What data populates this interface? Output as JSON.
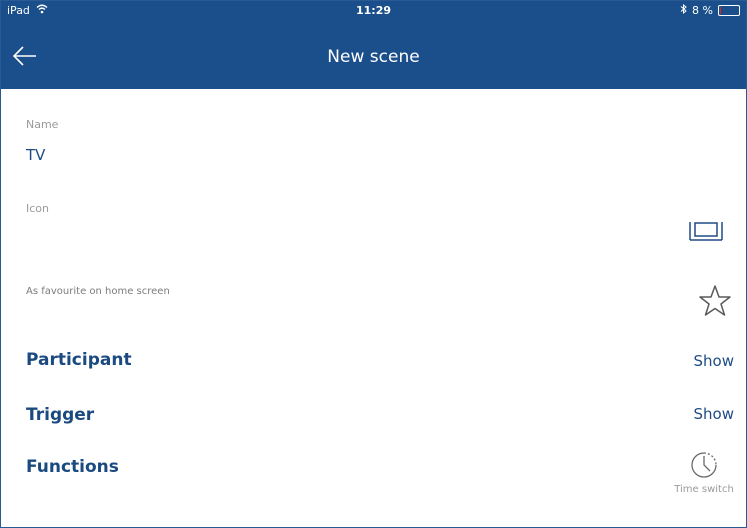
{
  "status_bar": {
    "device": "iPad",
    "time": "11:29",
    "battery_text": "8 %",
    "battery_level": 0.08,
    "battery_color": "#e0211f"
  },
  "nav": {
    "title": "New scene",
    "back_icon": "arrow-left-icon"
  },
  "form": {
    "name_label": "Name",
    "name_value": "TV",
    "icon_label": "Icon",
    "icon_value": "tv-icon",
    "favourite_label": "As favourite on home screen",
    "favourite_icon": "star-outline-icon"
  },
  "sections": {
    "participant": {
      "label": "Participant",
      "action": "Show"
    },
    "trigger": {
      "label": "Trigger",
      "action": "Show"
    },
    "functions": {
      "label": "Functions",
      "action_label": "Time switch",
      "action_icon": "clock-icon"
    }
  },
  "colors": {
    "header": "#1b4f8b",
    "accent": "#1f4c84"
  }
}
